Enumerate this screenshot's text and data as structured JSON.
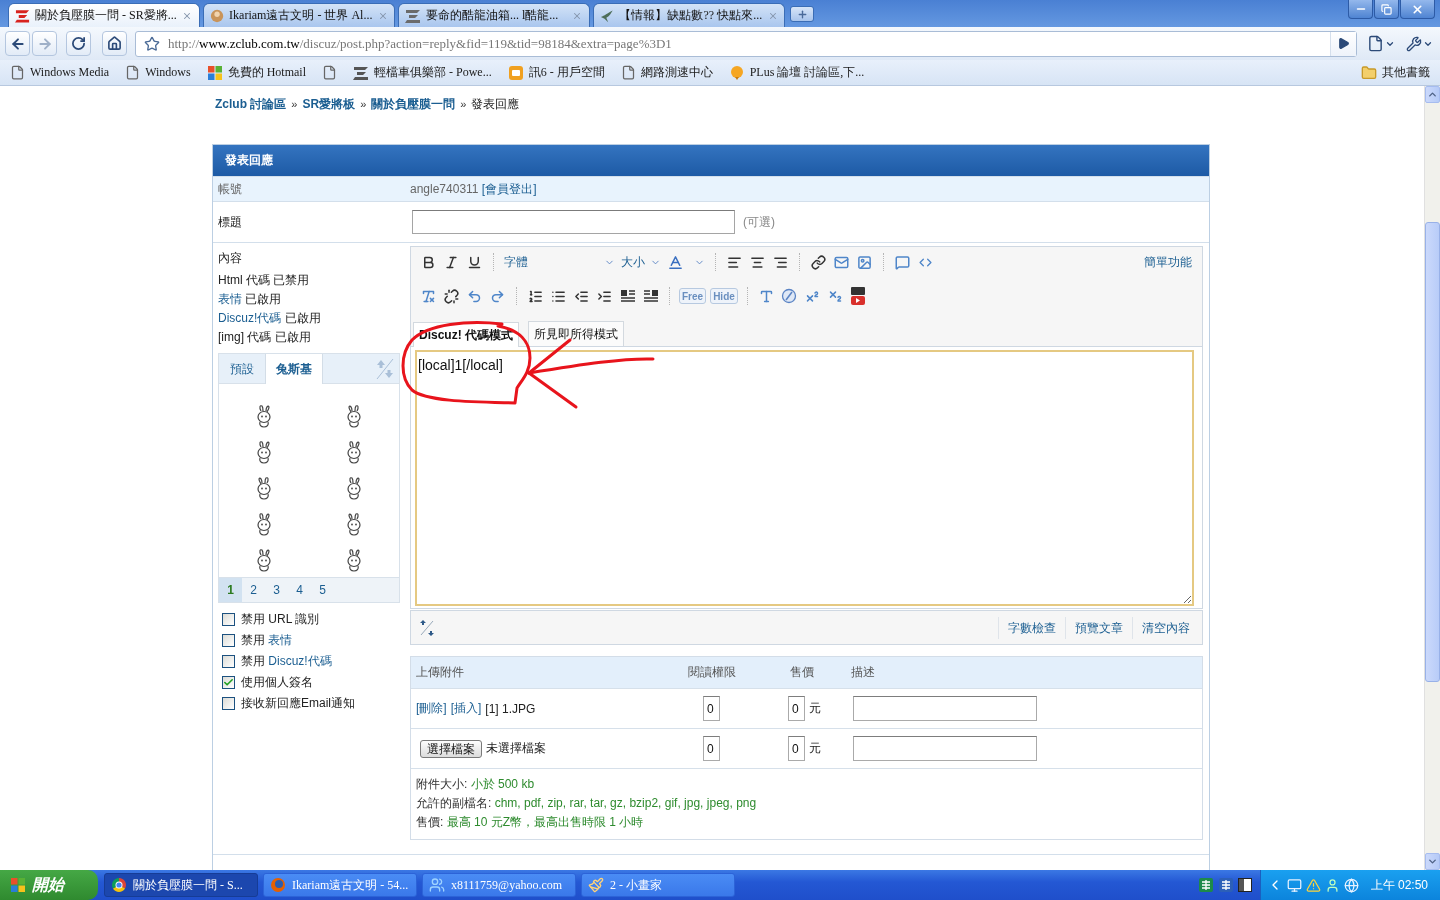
{
  "browser": {
    "tabs": [
      {
        "title": "關於負壓膜一問 - SR愛將...",
        "selected": true
      },
      {
        "title": "Ikariam遠古文明 - 世界 Al...",
        "selected": false
      },
      {
        "title": "要命的酷龍油箱... l酷龍...",
        "selected": false
      },
      {
        "title": "【情報】缺點數?? 快點來...",
        "selected": false
      }
    ],
    "url": {
      "scheme": "http://",
      "host": "www.zclub.com.tw",
      "path": "/discuz/post.php?action=reply&fid=119&tid=98184&extra=page%3D1"
    },
    "bookmarks": [
      {
        "kind": "labeled",
        "label": "Windows Media"
      },
      {
        "kind": "labeled",
        "label": "Windows"
      },
      {
        "kind": "labeled",
        "label": "免費的 Hotmail"
      },
      {
        "kind": "icon_only"
      },
      {
        "kind": "labeled",
        "label": "輕檔車俱樂部 - Powe..."
      },
      {
        "kind": "labeled",
        "label": "訊6 - 用戶空間"
      },
      {
        "kind": "labeled",
        "label": "網路測速中心"
      },
      {
        "kind": "labeled",
        "label": "PLus 論壇 討論區,下..."
      }
    ],
    "other_bookmarks": "其他書籤"
  },
  "breadcrumb": [
    {
      "kind": "link",
      "label": "Zclub 討論區"
    },
    {
      "kind": "separator",
      "label": "»"
    },
    {
      "kind": "link",
      "label": "SR愛將板"
    },
    {
      "kind": "separator",
      "label": "»"
    },
    {
      "kind": "link",
      "label": "關於負壓膜一問"
    },
    {
      "kind": "separator",
      "label": "»"
    },
    {
      "kind": "current",
      "label": "發表回應"
    }
  ],
  "form": {
    "title": "發表回應",
    "account": {
      "label": "帳號",
      "username": "angle740311",
      "logout": "[會員登出]"
    },
    "subject": {
      "label": "標題",
      "hint": "(可選)"
    },
    "content": {
      "label": "內容",
      "settings": [
        {
          "name": "Html 代碼",
          "status": "已禁用",
          "linked": false
        },
        {
          "name": "表情",
          "status": "已啟用",
          "linked": true
        },
        {
          "name": "Discuz!代碼",
          "status": "已啟用",
          "linked": true
        },
        {
          "name": "[img] 代碼",
          "status": "已啟用",
          "linked": false
        }
      ],
      "smilies": {
        "tabs": [
          {
            "label": "預設",
            "selected": false
          },
          {
            "label": "兔斯基",
            "selected": true
          }
        ],
        "pages": [
          {
            "label": "1",
            "selected": true
          },
          {
            "label": "2",
            "selected": false
          },
          {
            "label": "3",
            "selected": false
          },
          {
            "label": "4",
            "selected": false
          },
          {
            "label": "5",
            "selected": false
          }
        ]
      },
      "options": [
        {
          "text": "禁用 URL 識別",
          "checked": false
        },
        {
          "text": "禁用",
          "link": "表情",
          "checked": false
        },
        {
          "text": "禁用",
          "link": "Discuz!代碼",
          "checked": false
        },
        {
          "text": "使用個人簽名",
          "checked": true
        },
        {
          "text": "接收新回應Email通知",
          "checked": false
        }
      ]
    },
    "editor": {
      "font": "字體",
      "size": "大小",
      "tag_buttons": [
        "Free",
        "Hide"
      ],
      "simple_mode": "簡單功能",
      "modes": [
        {
          "label": "Discuz! 代碼模式",
          "selected": true
        },
        {
          "label": "所見即所得模式",
          "selected": false
        }
      ],
      "value": "[local]1[/local]",
      "actions": [
        "字數檢查",
        "預覽文章",
        "清空內容"
      ]
    },
    "attachments": {
      "columns": [
        "上傳附件",
        "閱讀權限",
        "售價",
        "描述"
      ],
      "rows": [
        {
          "kind": "uploaded",
          "links": [
            "[刪除]",
            "[插入]"
          ],
          "file": "[1] 1.JPG",
          "permission": "0",
          "price": "0",
          "unit": "元"
        },
        {
          "kind": "new",
          "button": "選擇檔案",
          "file": "未選擇檔案",
          "permission": "0",
          "price": "0",
          "unit": "元"
        }
      ],
      "notes": [
        {
          "label": "附件大小:",
          "value": "小於 500 kb"
        },
        {
          "label": "允許的副檔名:",
          "value": "chm, pdf, zip, rar, tar, gz, bzip2, gif, jpg, jpeg, png"
        },
        {
          "label": "售價:",
          "value": "最高 10 元Z幣，最高出售時限 1 小時"
        }
      ]
    }
  },
  "taskbar": {
    "start": "開始",
    "items": [
      {
        "title": "關於負壓膜一問 - S...",
        "selected": true
      },
      {
        "title": "Ikariam遠古文明 - 54...",
        "selected": false
      },
      {
        "title": "x8111759@yahoo.com",
        "selected": false
      },
      {
        "title": "2 - 小畫家",
        "selected": false
      }
    ],
    "clock": "上午 02:50"
  }
}
